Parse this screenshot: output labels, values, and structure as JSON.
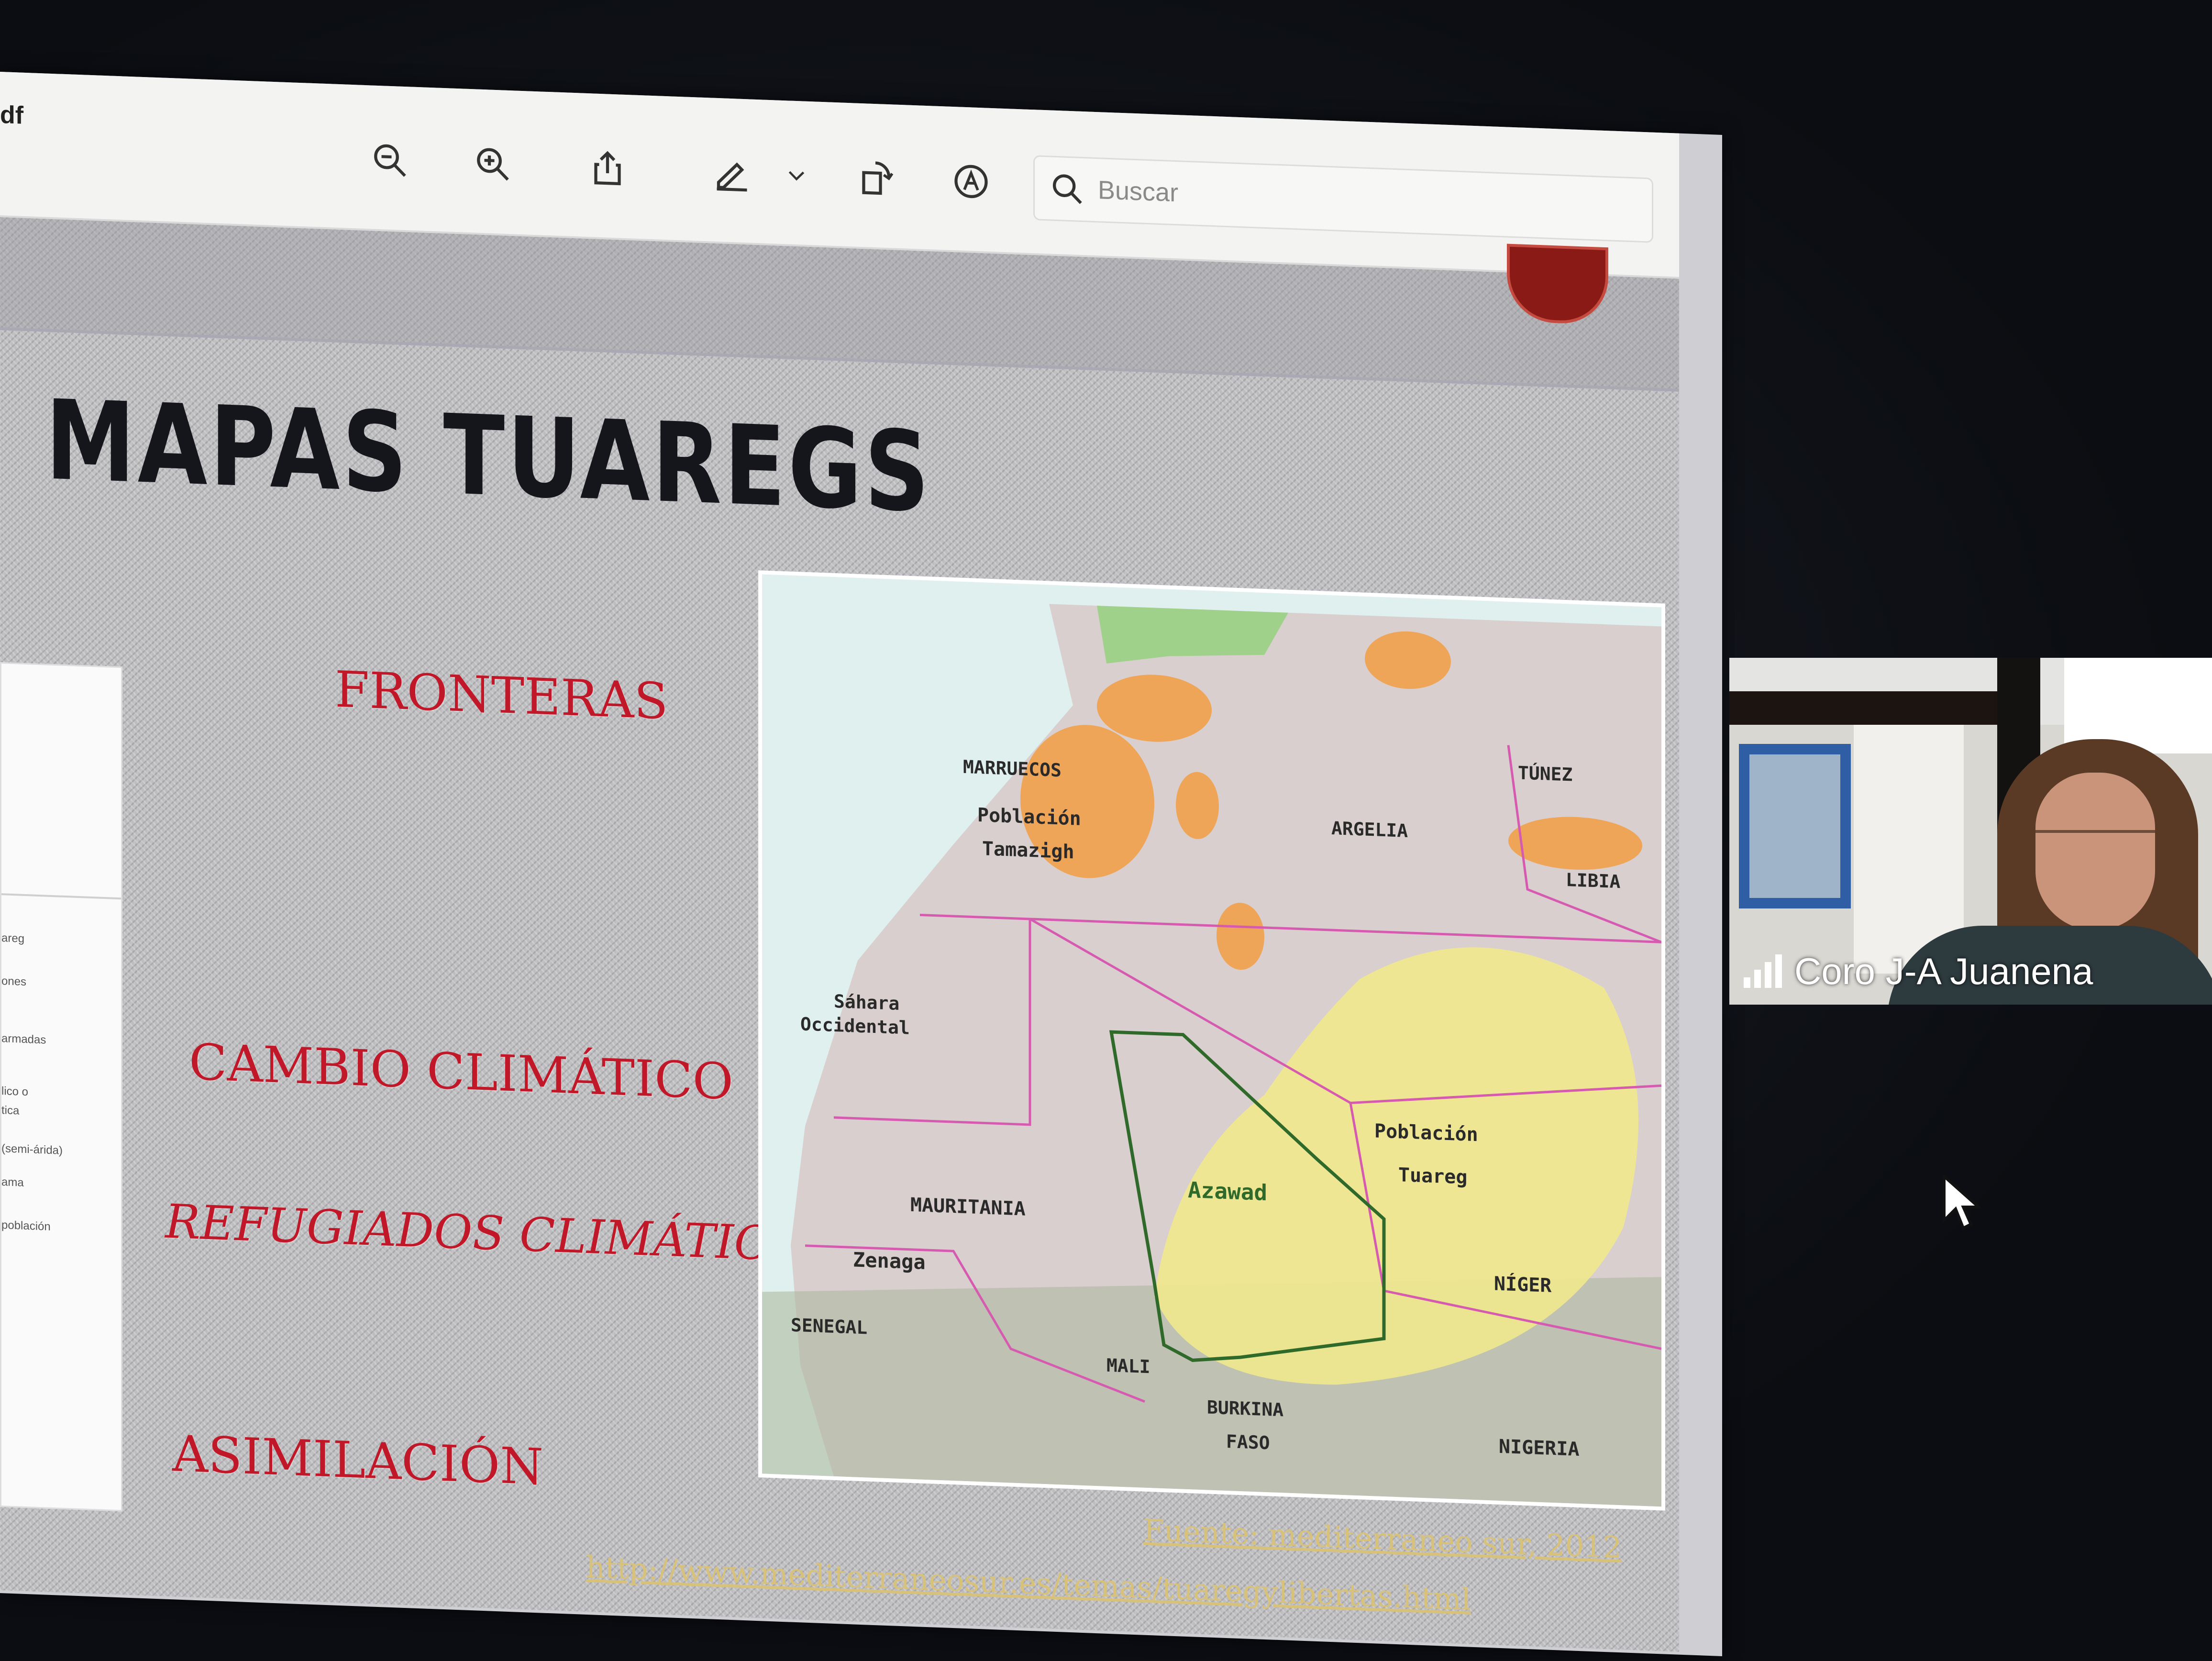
{
  "viewer": {
    "filename": "df",
    "toolbar": {
      "zoom_out_icon": "zoom-out-icon",
      "zoom_in_icon": "zoom-in-icon",
      "share_icon": "share-icon",
      "annotate_icon": "pen-icon",
      "dropdown_icon": "chevron-down-icon",
      "rotate_icon": "rotate-icon",
      "markup_icon": "markup-icon"
    },
    "search": {
      "placeholder": "Buscar"
    }
  },
  "slide": {
    "title": "MAPAS TUAREGS",
    "topics": {
      "fronteras": "FRONTERAS",
      "cambio": "CAMBIO CLIMÁTICO",
      "refugiados": "REFUGIADOS CLIMÁTICOS",
      "asimilacion": "ASIMILACIÓN"
    },
    "left_panel_snippets": [
      "areg",
      "ones",
      "armadas",
      "lico o",
      "tica",
      "(semi-árida)",
      "ama",
      "población"
    ],
    "map": {
      "labels": {
        "marruecos": "MARRUECOS",
        "tamazigh1": "Población",
        "tamazigh2": "Tamazigh",
        "argelia": "ARGELIA",
        "tunez": "TÚNEZ",
        "libia": "LIBIA",
        "sahara1": "Sáhara",
        "sahara2": "Occidental",
        "mauritania": "MAURITANIA",
        "zenaga": "Zenaga",
        "azawad": "Azawad",
        "tuareg1": "Población",
        "tuareg2": "Tuareg",
        "niger": "NÍGER",
        "senegal": "SENEGAL",
        "mali": "MALI",
        "burkina1": "BURKINA",
        "burkina2": "FASO",
        "nigeria": "NIGERIA"
      },
      "colors": {
        "sea": "#dff0ee",
        "land": "#d9cfcf",
        "tamazigh": "#f39a3a",
        "tuareg": "#f2ea8a",
        "border": "#d65bb0",
        "azawad": "#2f6a2a"
      }
    },
    "source": {
      "line1": "Fuente: mediterraneo sur, 2012",
      "line2": "http://www.mediterraneosur.es/temas/tuaregylibertas.html"
    }
  },
  "video": {
    "participant_name": "Coro J-A Juanena",
    "signal_icon": "signal-bars-icon"
  }
}
